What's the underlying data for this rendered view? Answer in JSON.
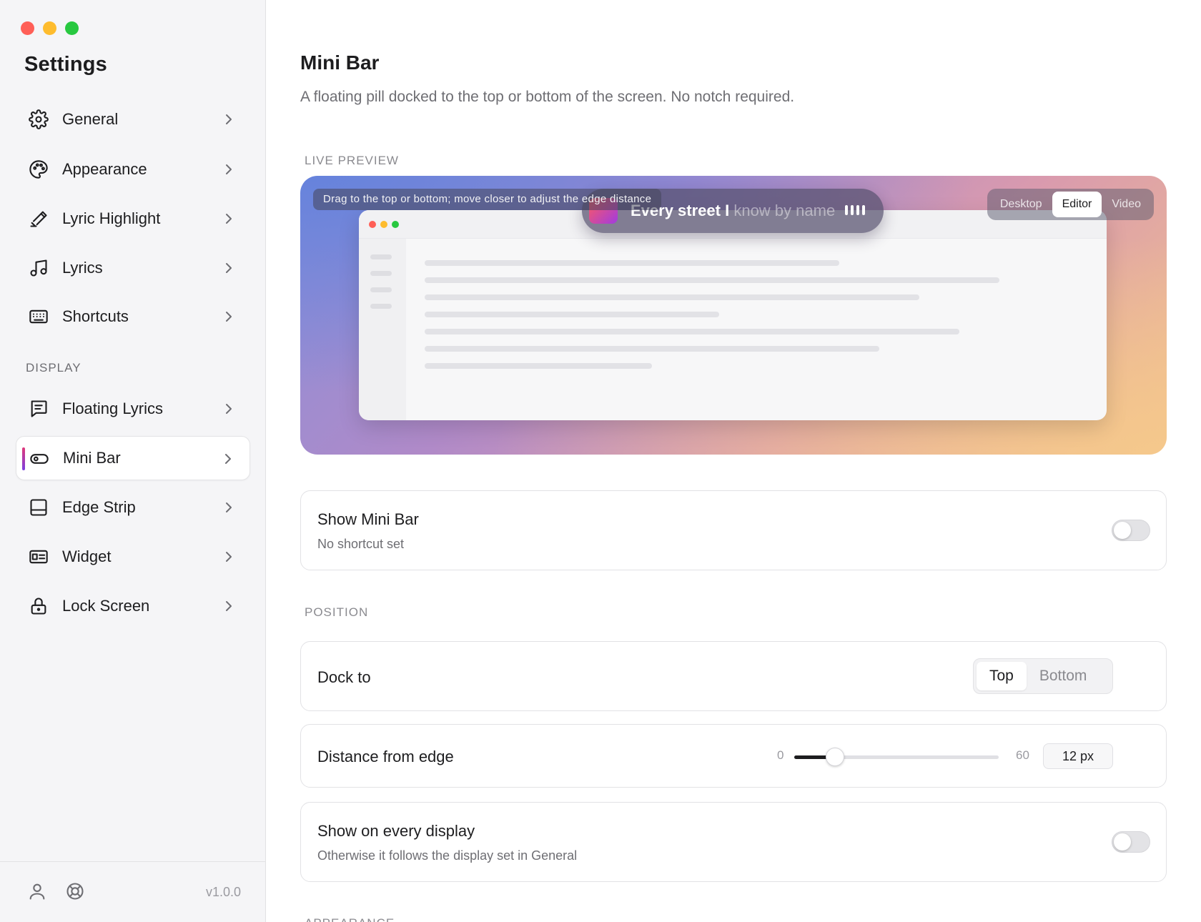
{
  "window": {
    "title": "Settings"
  },
  "sidebar": {
    "title": "Settings",
    "items": [
      {
        "label": "General",
        "icon": "gear-icon"
      },
      {
        "label": "Appearance",
        "icon": "palette-icon"
      },
      {
        "label": "Lyric Highlight",
        "icon": "highlighter-icon"
      },
      {
        "label": "Lyrics",
        "icon": "music-note-icon"
      },
      {
        "label": "Shortcuts",
        "icon": "keyboard-icon"
      }
    ],
    "section_display": "DISPLAY",
    "display_items": [
      {
        "label": "Floating Lyrics",
        "icon": "message-square-icon"
      },
      {
        "label": "Mini Bar",
        "icon": "pill-icon",
        "active": true
      },
      {
        "label": "Edge Strip",
        "icon": "panel-bottom-icon"
      },
      {
        "label": "Widget",
        "icon": "id-card-icon"
      },
      {
        "label": "Lock Screen",
        "icon": "lock-icon"
      }
    ],
    "footer": {
      "version": "v1.0.0"
    }
  },
  "main": {
    "title": "Mini Bar",
    "subtitle": "A floating pill docked to the top or bottom of the screen. No notch required.",
    "live_preview": {
      "section_label": "LIVE PREVIEW",
      "hint": "Drag to the top or bottom; move closer to adjust the edge distance",
      "lyric_sung": "Every street I",
      "lyric_upcoming": "know by name",
      "view_options": [
        "Desktop",
        "Editor",
        "Video"
      ],
      "view_selected": "Editor"
    },
    "show_mini_bar": {
      "title": "Show Mini Bar",
      "subtitle": "No shortcut set",
      "enabled": false
    },
    "position": {
      "section_label": "POSITION",
      "dock_to": {
        "label": "Dock to",
        "options": [
          "Top",
          "Bottom"
        ],
        "selected": "Top"
      },
      "distance": {
        "label": "Distance from edge",
        "min": "0",
        "max": "60",
        "value": 12,
        "value_text": "12 px"
      },
      "every_display": {
        "title": "Show on every display",
        "subtitle": "Otherwise it follows the display set in General",
        "enabled": false
      }
    },
    "next_section_label": "APPEARANCE"
  },
  "colors": {
    "accent_gradient_start": "#e0397a",
    "accent_gradient_end": "#7d3fe0",
    "traffic_red": "#ff5f57",
    "traffic_yellow": "#febc2e",
    "traffic_green": "#28c840"
  }
}
